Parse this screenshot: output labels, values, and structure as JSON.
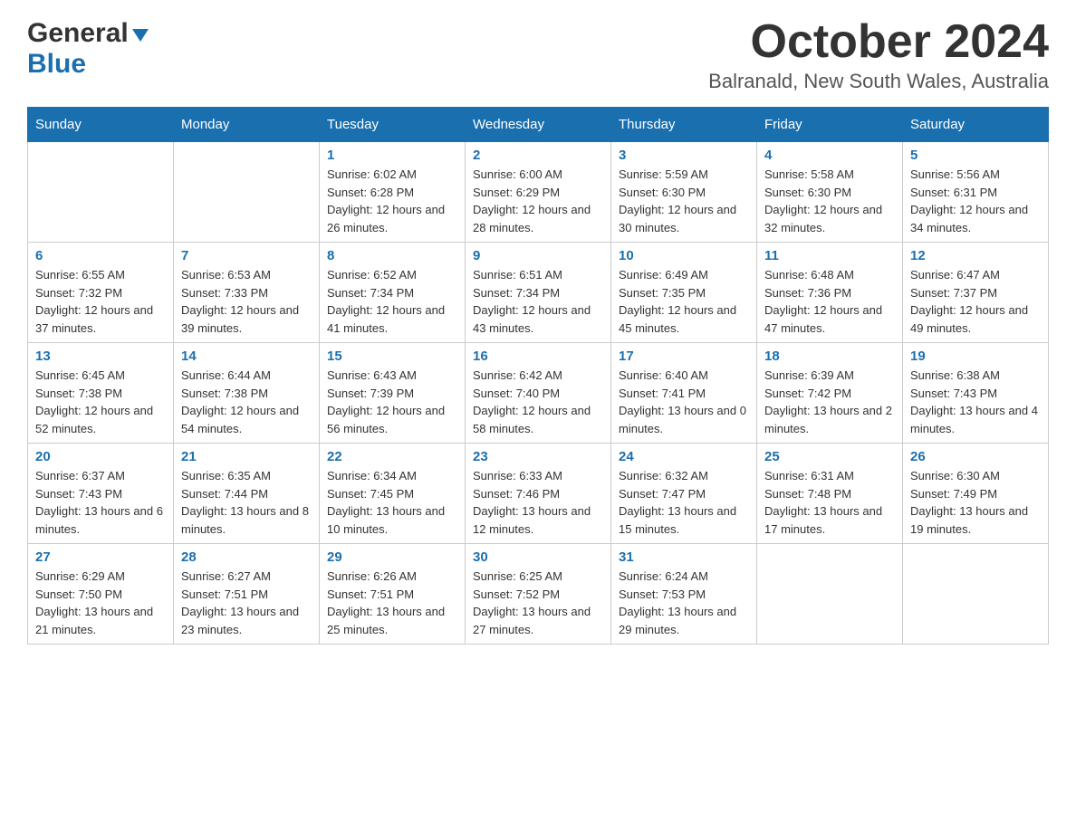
{
  "header": {
    "logo_general": "General",
    "logo_blue": "Blue",
    "month_title": "October 2024",
    "location": "Balranald, New South Wales, Australia"
  },
  "days_of_week": [
    "Sunday",
    "Monday",
    "Tuesday",
    "Wednesday",
    "Thursday",
    "Friday",
    "Saturday"
  ],
  "weeks": [
    [
      {
        "day": "",
        "sunrise": "",
        "sunset": "",
        "daylight": ""
      },
      {
        "day": "",
        "sunrise": "",
        "sunset": "",
        "daylight": ""
      },
      {
        "day": "1",
        "sunrise": "Sunrise: 6:02 AM",
        "sunset": "Sunset: 6:28 PM",
        "daylight": "Daylight: 12 hours and 26 minutes."
      },
      {
        "day": "2",
        "sunrise": "Sunrise: 6:00 AM",
        "sunset": "Sunset: 6:29 PM",
        "daylight": "Daylight: 12 hours and 28 minutes."
      },
      {
        "day": "3",
        "sunrise": "Sunrise: 5:59 AM",
        "sunset": "Sunset: 6:30 PM",
        "daylight": "Daylight: 12 hours and 30 minutes."
      },
      {
        "day": "4",
        "sunrise": "Sunrise: 5:58 AM",
        "sunset": "Sunset: 6:30 PM",
        "daylight": "Daylight: 12 hours and 32 minutes."
      },
      {
        "day": "5",
        "sunrise": "Sunrise: 5:56 AM",
        "sunset": "Sunset: 6:31 PM",
        "daylight": "Daylight: 12 hours and 34 minutes."
      }
    ],
    [
      {
        "day": "6",
        "sunrise": "Sunrise: 6:55 AM",
        "sunset": "Sunset: 7:32 PM",
        "daylight": "Daylight: 12 hours and 37 minutes."
      },
      {
        "day": "7",
        "sunrise": "Sunrise: 6:53 AM",
        "sunset": "Sunset: 7:33 PM",
        "daylight": "Daylight: 12 hours and 39 minutes."
      },
      {
        "day": "8",
        "sunrise": "Sunrise: 6:52 AM",
        "sunset": "Sunset: 7:34 PM",
        "daylight": "Daylight: 12 hours and 41 minutes."
      },
      {
        "day": "9",
        "sunrise": "Sunrise: 6:51 AM",
        "sunset": "Sunset: 7:34 PM",
        "daylight": "Daylight: 12 hours and 43 minutes."
      },
      {
        "day": "10",
        "sunrise": "Sunrise: 6:49 AM",
        "sunset": "Sunset: 7:35 PM",
        "daylight": "Daylight: 12 hours and 45 minutes."
      },
      {
        "day": "11",
        "sunrise": "Sunrise: 6:48 AM",
        "sunset": "Sunset: 7:36 PM",
        "daylight": "Daylight: 12 hours and 47 minutes."
      },
      {
        "day": "12",
        "sunrise": "Sunrise: 6:47 AM",
        "sunset": "Sunset: 7:37 PM",
        "daylight": "Daylight: 12 hours and 49 minutes."
      }
    ],
    [
      {
        "day": "13",
        "sunrise": "Sunrise: 6:45 AM",
        "sunset": "Sunset: 7:38 PM",
        "daylight": "Daylight: 12 hours and 52 minutes."
      },
      {
        "day": "14",
        "sunrise": "Sunrise: 6:44 AM",
        "sunset": "Sunset: 7:38 PM",
        "daylight": "Daylight: 12 hours and 54 minutes."
      },
      {
        "day": "15",
        "sunrise": "Sunrise: 6:43 AM",
        "sunset": "Sunset: 7:39 PM",
        "daylight": "Daylight: 12 hours and 56 minutes."
      },
      {
        "day": "16",
        "sunrise": "Sunrise: 6:42 AM",
        "sunset": "Sunset: 7:40 PM",
        "daylight": "Daylight: 12 hours and 58 minutes."
      },
      {
        "day": "17",
        "sunrise": "Sunrise: 6:40 AM",
        "sunset": "Sunset: 7:41 PM",
        "daylight": "Daylight: 13 hours and 0 minutes."
      },
      {
        "day": "18",
        "sunrise": "Sunrise: 6:39 AM",
        "sunset": "Sunset: 7:42 PM",
        "daylight": "Daylight: 13 hours and 2 minutes."
      },
      {
        "day": "19",
        "sunrise": "Sunrise: 6:38 AM",
        "sunset": "Sunset: 7:43 PM",
        "daylight": "Daylight: 13 hours and 4 minutes."
      }
    ],
    [
      {
        "day": "20",
        "sunrise": "Sunrise: 6:37 AM",
        "sunset": "Sunset: 7:43 PM",
        "daylight": "Daylight: 13 hours and 6 minutes."
      },
      {
        "day": "21",
        "sunrise": "Sunrise: 6:35 AM",
        "sunset": "Sunset: 7:44 PM",
        "daylight": "Daylight: 13 hours and 8 minutes."
      },
      {
        "day": "22",
        "sunrise": "Sunrise: 6:34 AM",
        "sunset": "Sunset: 7:45 PM",
        "daylight": "Daylight: 13 hours and 10 minutes."
      },
      {
        "day": "23",
        "sunrise": "Sunrise: 6:33 AM",
        "sunset": "Sunset: 7:46 PM",
        "daylight": "Daylight: 13 hours and 12 minutes."
      },
      {
        "day": "24",
        "sunrise": "Sunrise: 6:32 AM",
        "sunset": "Sunset: 7:47 PM",
        "daylight": "Daylight: 13 hours and 15 minutes."
      },
      {
        "day": "25",
        "sunrise": "Sunrise: 6:31 AM",
        "sunset": "Sunset: 7:48 PM",
        "daylight": "Daylight: 13 hours and 17 minutes."
      },
      {
        "day": "26",
        "sunrise": "Sunrise: 6:30 AM",
        "sunset": "Sunset: 7:49 PM",
        "daylight": "Daylight: 13 hours and 19 minutes."
      }
    ],
    [
      {
        "day": "27",
        "sunrise": "Sunrise: 6:29 AM",
        "sunset": "Sunset: 7:50 PM",
        "daylight": "Daylight: 13 hours and 21 minutes."
      },
      {
        "day": "28",
        "sunrise": "Sunrise: 6:27 AM",
        "sunset": "Sunset: 7:51 PM",
        "daylight": "Daylight: 13 hours and 23 minutes."
      },
      {
        "day": "29",
        "sunrise": "Sunrise: 6:26 AM",
        "sunset": "Sunset: 7:51 PM",
        "daylight": "Daylight: 13 hours and 25 minutes."
      },
      {
        "day": "30",
        "sunrise": "Sunrise: 6:25 AM",
        "sunset": "Sunset: 7:52 PM",
        "daylight": "Daylight: 13 hours and 27 minutes."
      },
      {
        "day": "31",
        "sunrise": "Sunrise: 6:24 AM",
        "sunset": "Sunset: 7:53 PM",
        "daylight": "Daylight: 13 hours and 29 minutes."
      },
      {
        "day": "",
        "sunrise": "",
        "sunset": "",
        "daylight": ""
      },
      {
        "day": "",
        "sunrise": "",
        "sunset": "",
        "daylight": ""
      }
    ]
  ]
}
